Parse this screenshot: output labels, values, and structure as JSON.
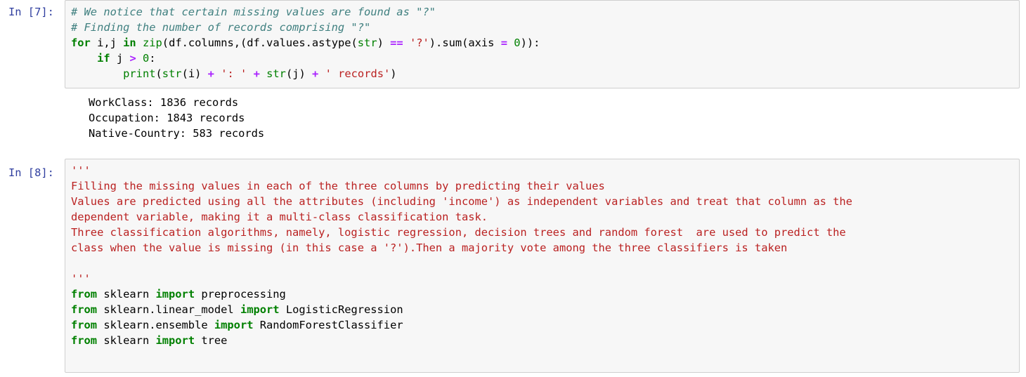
{
  "cells": [
    {
      "prompt": "In [7]:",
      "code": [
        [
          {
            "t": "cm-comment",
            "v": "# We notice that certain missing values are found as \"?\""
          }
        ],
        [
          {
            "t": "cm-comment",
            "v": "# Finding the number of records comprising \"?\""
          }
        ],
        [
          {
            "t": "cm-keyword",
            "v": "for"
          },
          {
            "t": "cm-text",
            "v": " i,j "
          },
          {
            "t": "cm-keyword",
            "v": "in"
          },
          {
            "t": "cm-text",
            "v": " "
          },
          {
            "t": "cm-builtin",
            "v": "zip"
          },
          {
            "t": "cm-text",
            "v": "(df.columns,(df.values.astype("
          },
          {
            "t": "cm-builtin",
            "v": "str"
          },
          {
            "t": "cm-text",
            "v": ") "
          },
          {
            "t": "cm-operator",
            "v": "=="
          },
          {
            "t": "cm-text",
            "v": " "
          },
          {
            "t": "cm-string",
            "v": "'?'"
          },
          {
            "t": "cm-text",
            "v": ").sum(axis "
          },
          {
            "t": "cm-operator",
            "v": "="
          },
          {
            "t": "cm-text",
            "v": " "
          },
          {
            "t": "cm-number",
            "v": "0"
          },
          {
            "t": "cm-text",
            "v": ")):"
          }
        ],
        [
          {
            "t": "cm-text",
            "v": "    "
          },
          {
            "t": "cm-keyword",
            "v": "if"
          },
          {
            "t": "cm-text",
            "v": " j "
          },
          {
            "t": "cm-operator",
            "v": ">"
          },
          {
            "t": "cm-text",
            "v": " "
          },
          {
            "t": "cm-number",
            "v": "0"
          },
          {
            "t": "cm-text",
            "v": ":"
          }
        ],
        [
          {
            "t": "cm-text",
            "v": "        "
          },
          {
            "t": "cm-builtin",
            "v": "print"
          },
          {
            "t": "cm-text",
            "v": "("
          },
          {
            "t": "cm-builtin",
            "v": "str"
          },
          {
            "t": "cm-text",
            "v": "(i) "
          },
          {
            "t": "cm-operator",
            "v": "+"
          },
          {
            "t": "cm-text",
            "v": " "
          },
          {
            "t": "cm-string",
            "v": "': '"
          },
          {
            "t": "cm-text",
            "v": " "
          },
          {
            "t": "cm-operator",
            "v": "+"
          },
          {
            "t": "cm-text",
            "v": " "
          },
          {
            "t": "cm-builtin",
            "v": "str"
          },
          {
            "t": "cm-text",
            "v": "(j) "
          },
          {
            "t": "cm-operator",
            "v": "+"
          },
          {
            "t": "cm-text",
            "v": " "
          },
          {
            "t": "cm-string",
            "v": "' records'"
          },
          {
            "t": "cm-text",
            "v": ")"
          }
        ]
      ],
      "output": [
        "WorkClass: 1836 records",
        "Occupation: 1843 records",
        "Native-Country: 583 records"
      ]
    },
    {
      "prompt": "In [8]:",
      "code": [
        [
          {
            "t": "cm-string",
            "v": "'''"
          }
        ],
        [
          {
            "t": "cm-string",
            "v": "Filling the missing values in each of the three columns by predicting their values"
          }
        ],
        [
          {
            "t": "cm-string",
            "v": "Values are predicted using all the attributes (including 'income') as independent variables and treat that column as the"
          }
        ],
        [
          {
            "t": "cm-string",
            "v": "dependent variable, making it a multi-class classification task."
          }
        ],
        [
          {
            "t": "cm-string",
            "v": "Three classification algorithms, namely, logistic regression, decision trees and random forest  are used to predict the"
          }
        ],
        [
          {
            "t": "cm-string",
            "v": "class when the value is missing (in this case a '?').Then a majority vote among the three classifiers is taken"
          }
        ],
        [
          {
            "t": "cm-string",
            "v": ""
          }
        ],
        [
          {
            "t": "cm-string",
            "v": "'''"
          }
        ],
        [
          {
            "t": "cm-keyword",
            "v": "from"
          },
          {
            "t": "cm-text",
            "v": " sklearn "
          },
          {
            "t": "cm-keyword",
            "v": "import"
          },
          {
            "t": "cm-text",
            "v": " preprocessing"
          }
        ],
        [
          {
            "t": "cm-keyword",
            "v": "from"
          },
          {
            "t": "cm-text",
            "v": " sklearn.linear_model "
          },
          {
            "t": "cm-keyword",
            "v": "import"
          },
          {
            "t": "cm-text",
            "v": " LogisticRegression"
          }
        ],
        [
          {
            "t": "cm-keyword",
            "v": "from"
          },
          {
            "t": "cm-text",
            "v": " sklearn.ensemble "
          },
          {
            "t": "cm-keyword",
            "v": "import"
          },
          {
            "t": "cm-text",
            "v": " RandomForestClassifier"
          }
        ],
        [
          {
            "t": "cm-keyword",
            "v": "from"
          },
          {
            "t": "cm-text",
            "v": " sklearn "
          },
          {
            "t": "cm-keyword",
            "v": "import"
          },
          {
            "t": "cm-text",
            "v": " tree"
          }
        ],
        [
          {
            "t": "cm-text",
            "v": ""
          }
        ]
      ],
      "output": []
    }
  ]
}
